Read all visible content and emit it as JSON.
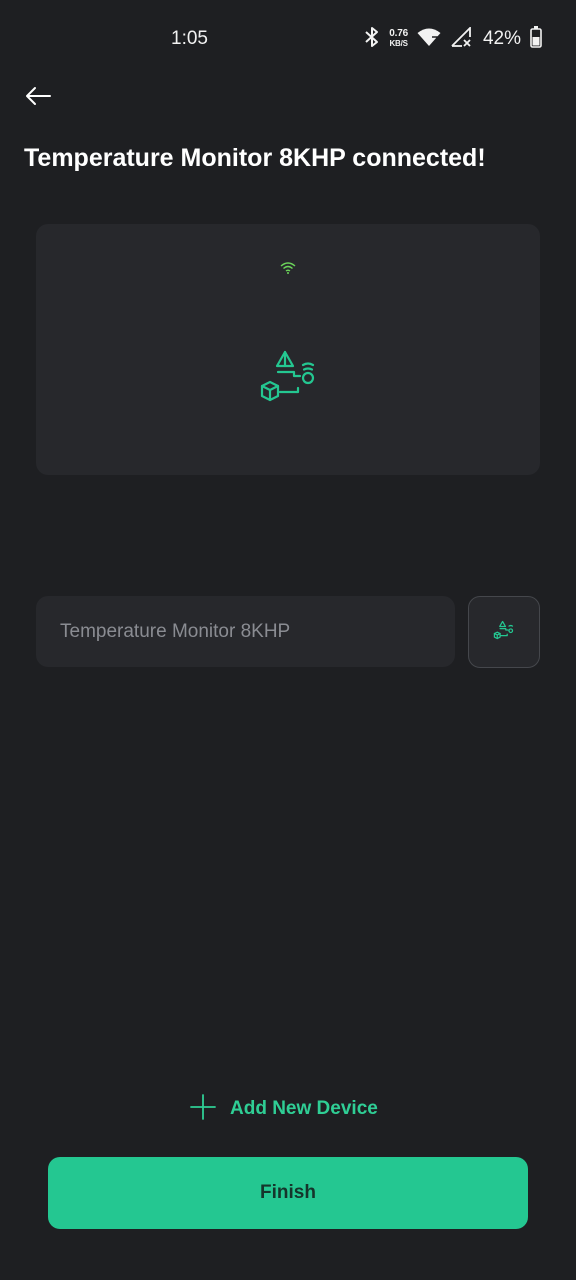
{
  "status_bar": {
    "time": "1:05",
    "net_speed_value": "0.76",
    "net_speed_unit": "KB/S",
    "battery_percent": "42%",
    "icons": [
      "bluetooth-icon",
      "wifi-icon",
      "signal-icon",
      "battery-icon"
    ]
  },
  "header": {
    "back_icon": "arrow-left-icon",
    "title": "Temperature Monitor 8KHP connected!"
  },
  "device_card": {
    "status_icon": "wifi-icon",
    "illustration": "device-illustration-icon"
  },
  "name_field": {
    "value": "Temperature Monitor 8KHP",
    "icon_button": "device-icon"
  },
  "actions": {
    "add_device_label": "Add New Device",
    "finish_label": "Finish"
  },
  "colors": {
    "background": "#1e1f22",
    "card": "#27282c",
    "accent": "#24c791",
    "accent_text": "#2fce95",
    "wifi_green": "#6bd35a"
  }
}
